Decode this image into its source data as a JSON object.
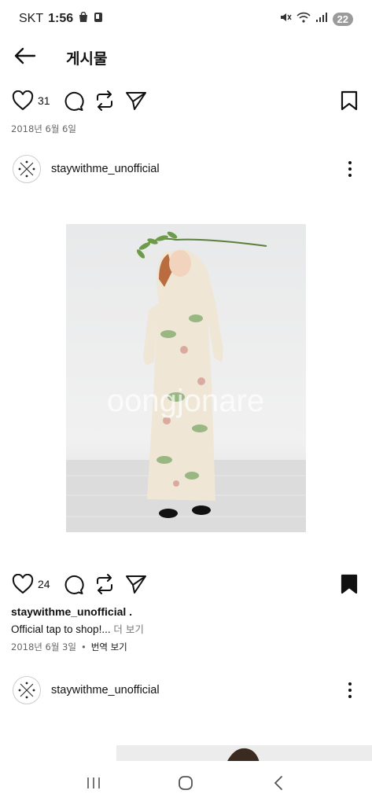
{
  "status_bar": {
    "carrier": "SKT",
    "time": "1:56",
    "battery": "22"
  },
  "header": {
    "title": "게시물",
    "back_icon": "arrow-left-icon"
  },
  "post1": {
    "likes": "31",
    "date": "2018년 6월 6일",
    "bookmarked": false
  },
  "post2": {
    "username": "staywithme_unofficial",
    "photo_watermark": "oongjonare",
    "likes": "24",
    "bookmarked": true,
    "caption_user": "staywithme_unofficial .",
    "caption_text": "Official tap to shop!...",
    "caption_more": "더 보기",
    "date": "2018년 6월 3일",
    "separator": "•",
    "translate": "번역 보기"
  },
  "post3": {
    "username": "staywithme_unofficial"
  },
  "colors": {
    "text": "#111111",
    "meta": "#666666",
    "battery_bg": "#9b9b9b"
  }
}
